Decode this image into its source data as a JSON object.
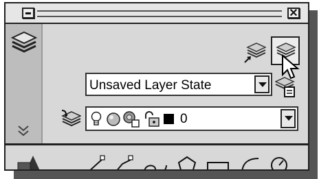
{
  "panel": {
    "layer_state_combo": {
      "value": "Unsaved Layer State"
    },
    "layer_combo": {
      "value": "0",
      "color": "#000000"
    }
  },
  "icons": [
    "minimize-icon",
    "close-icon",
    "layers-panel-icon",
    "expand-chevron-icon",
    "layer-states-manager-icon",
    "layer-properties-manager-icon",
    "mouse-cursor-icon",
    "layer-previous-icon",
    "make-object-layer-current-icon",
    "lightbulb-on-icon",
    "freeze-thaw-icon",
    "viewport-freeze-icon",
    "unlock-icon",
    "color-swatch-icon",
    "draw-panel-icon",
    "line-tool-icon",
    "polyline-tool-icon",
    "polyline-curve-tool-icon",
    "polygon-tool-icon",
    "rectangle-tool-icon",
    "arc-tool-icon",
    "circle-tool-icon"
  ]
}
